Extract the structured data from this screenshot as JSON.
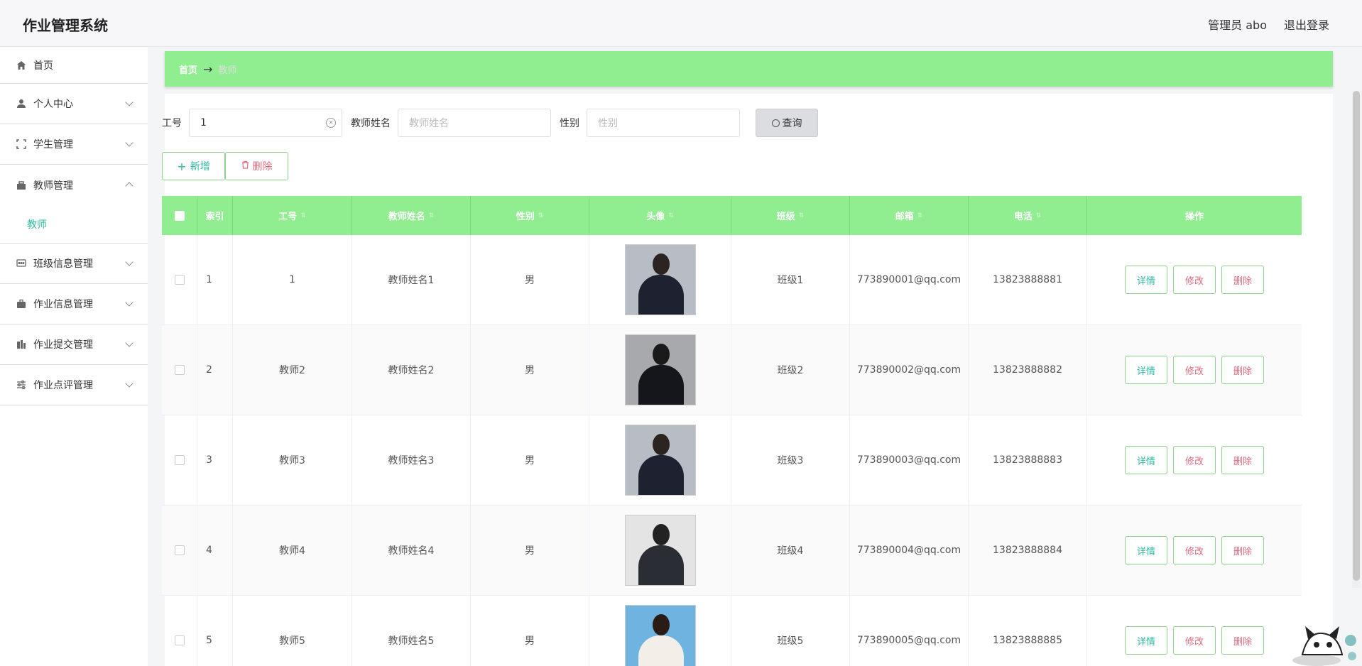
{
  "header": {
    "app_title": "作业管理系统",
    "user_label": "管理员 abo",
    "logout_label": "退出登录"
  },
  "sidebar": {
    "items": [
      {
        "label": "首页",
        "icon": "home-icon",
        "expandable": false
      },
      {
        "label": "个人中心",
        "icon": "user-icon",
        "expandable": true
      },
      {
        "label": "学生管理",
        "icon": "fullscreen-icon",
        "expandable": true
      },
      {
        "label": "教师管理",
        "icon": "briefcase-icon",
        "expandable": true,
        "expanded": true,
        "subitems": [
          "教师"
        ]
      },
      {
        "label": "班级信息管理",
        "icon": "chat-icon",
        "expandable": true
      },
      {
        "label": "作业信息管理",
        "icon": "suitcase-icon",
        "expandable": true
      },
      {
        "label": "作业提交管理",
        "icon": "building-icon",
        "expandable": true
      },
      {
        "label": "作业点评管理",
        "icon": "sliders-icon",
        "expandable": true
      }
    ]
  },
  "breadcrumb": {
    "home": "首页",
    "arrow": "→",
    "current": "教师"
  },
  "search": {
    "id_label": "工号",
    "id_value": "1",
    "name_label": "教师姓名",
    "name_placeholder": "教师姓名",
    "gender_label": "性别",
    "gender_placeholder": "性别",
    "query_label": "查询"
  },
  "actions": {
    "add_label": "新增",
    "delete_label": "删除"
  },
  "table": {
    "columns": [
      "索引",
      "工号",
      "教师姓名",
      "性别",
      "头像",
      "班级",
      "邮箱",
      "电话",
      "操作"
    ],
    "rows": [
      {
        "index": "1",
        "id": "1",
        "name": "教师姓名1",
        "gender": "男",
        "class": "班级1",
        "email": "773890001@qq.com",
        "phone": "13823888881"
      },
      {
        "index": "2",
        "id": "教师2",
        "name": "教师姓名2",
        "gender": "男",
        "class": "班级2",
        "email": "773890002@qq.com",
        "phone": "13823888882"
      },
      {
        "index": "3",
        "id": "教师3",
        "name": "教师姓名3",
        "gender": "男",
        "class": "班级3",
        "email": "773890003@qq.com",
        "phone": "13823888883"
      },
      {
        "index": "4",
        "id": "教师4",
        "name": "教师姓名4",
        "gender": "男",
        "class": "班级4",
        "email": "773890004@qq.com",
        "phone": "13823888884"
      },
      {
        "index": "5",
        "id": "教师5",
        "name": "教师姓名5",
        "gender": "男",
        "class": "班级5",
        "email": "773890005@qq.com",
        "phone": "13823888885"
      }
    ],
    "op_detail": "详情",
    "op_edit": "修改",
    "op_delete": "删除"
  },
  "colors": {
    "accent_green": "#90ee90",
    "teal": "#2fb9a0",
    "pink": "#e06b7d"
  }
}
